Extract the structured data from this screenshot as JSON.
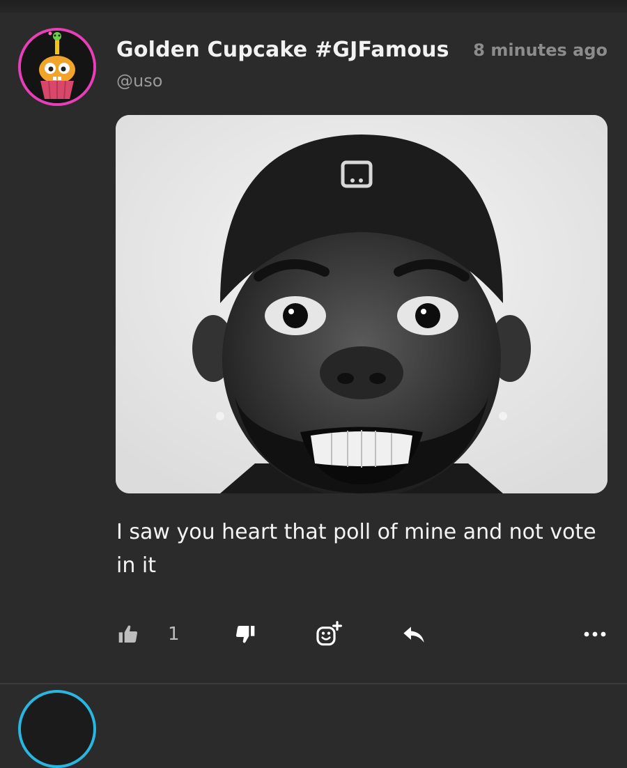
{
  "post": {
    "author_name": "Golden Cupcake #GJFamous",
    "author_handle": "@uso",
    "timestamp": "8 minutes ago",
    "body": "I saw you heart that poll of mine and not vote in it",
    "media_alt": "Black and white photo of a smiling man wearing a backwards cap",
    "actions": {
      "like_icon": "thumbs-up-icon",
      "like_count": "1",
      "dislike_icon": "thumbs-down-icon",
      "react_icon": "add-emoji-icon",
      "reply_icon": "reply-icon",
      "more_icon": "more-options-icon"
    },
    "colors": {
      "background": "#2b2b2b",
      "avatar_ring": "#e83fb8",
      "next_avatar_ring": "#29b6e0",
      "muted_text": "#9a9a9a"
    }
  }
}
